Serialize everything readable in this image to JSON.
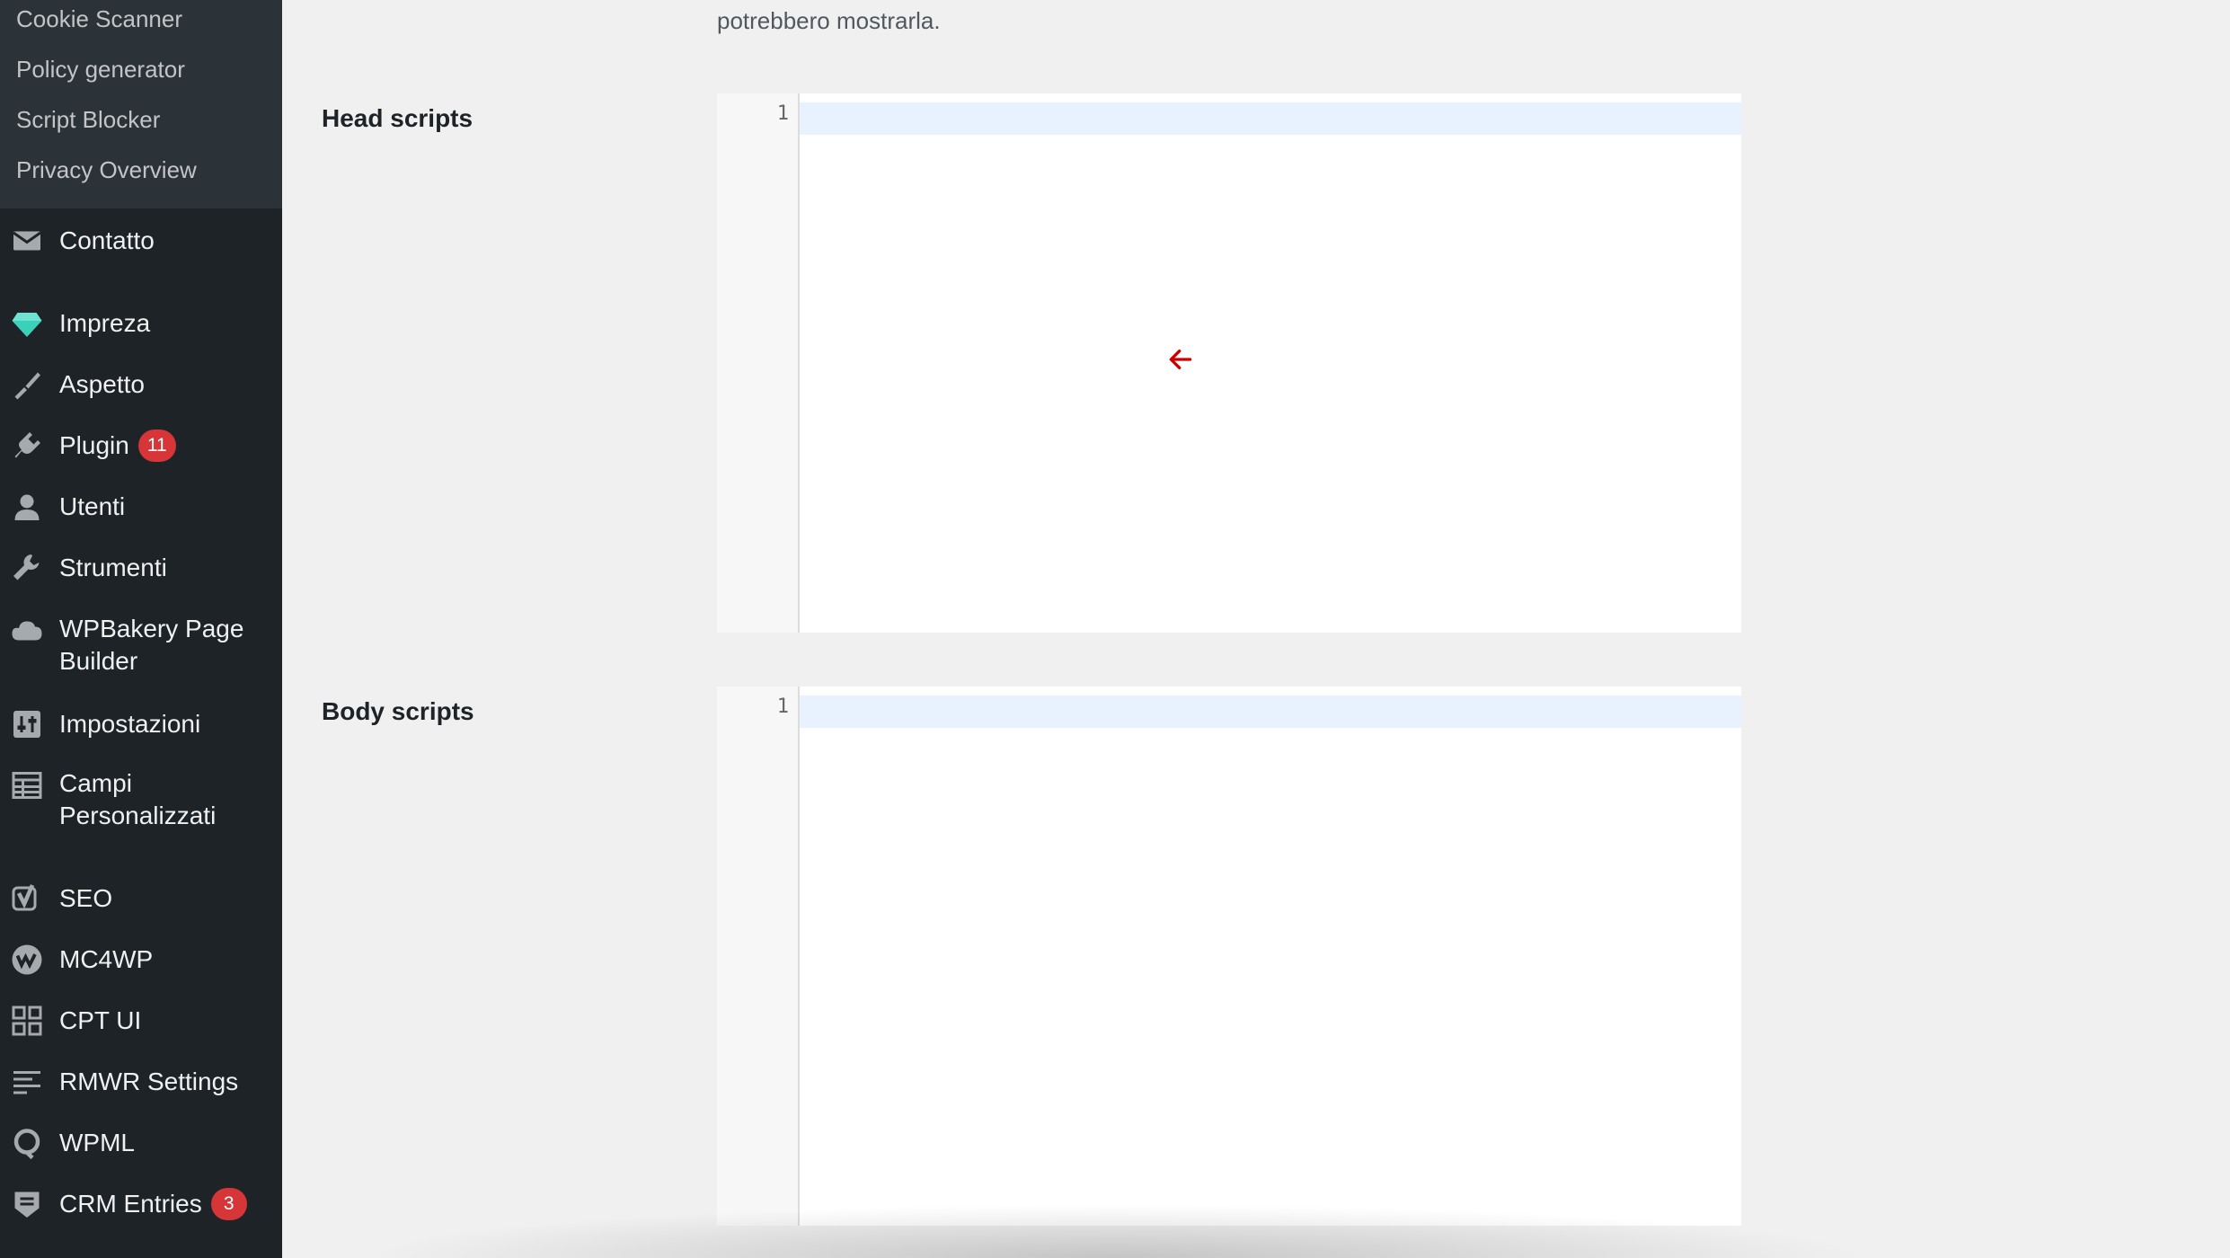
{
  "sidebar": {
    "submenu": [
      "Cookie Scanner",
      "Policy generator",
      "Script Blocker",
      "Privacy Overview"
    ],
    "items": [
      {
        "label": "Contatto",
        "icon": "envelope-icon"
      },
      {
        "label": "Impreza",
        "icon": "diamond-icon"
      },
      {
        "label": "Aspetto",
        "icon": "paintbrush-icon"
      },
      {
        "label": "Plugin",
        "icon": "plugin-icon",
        "badge": "11"
      },
      {
        "label": "Utenti",
        "icon": "user-icon"
      },
      {
        "label": "Strumenti",
        "icon": "wrench-icon"
      },
      {
        "label": "WPBakery Page Builder",
        "icon": "cloud-icon"
      },
      {
        "label": "Impostazioni",
        "icon": "settings-icon"
      },
      {
        "label": "Campi Personalizzati",
        "icon": "table-icon"
      },
      {
        "label": "SEO",
        "icon": "yoast-icon"
      },
      {
        "label": "MC4WP",
        "icon": "mc4wp-icon"
      },
      {
        "label": "CPT UI",
        "icon": "cpt-grid-icon"
      },
      {
        "label": "RMWR Settings",
        "icon": "list-settings-icon"
      },
      {
        "label": "WPML",
        "icon": "wpml-icon"
      },
      {
        "label": "CRM Entries",
        "icon": "crm-icon",
        "badge": "3"
      }
    ],
    "colors": {
      "background": "#1d2327",
      "submenu_background": "#2c3338",
      "badge": "#d63638",
      "diamond": "#3ad1b9"
    }
  },
  "main": {
    "intro_text": "potrebbero mostrarla.",
    "fields": [
      {
        "label": "Head scripts",
        "line_number": "1"
      },
      {
        "label": "Body scripts",
        "line_number": "1"
      }
    ],
    "cursor": "arrow-left-icon",
    "colors": {
      "cursor": "#cc0000",
      "active_line": "#e8f2fe"
    }
  }
}
